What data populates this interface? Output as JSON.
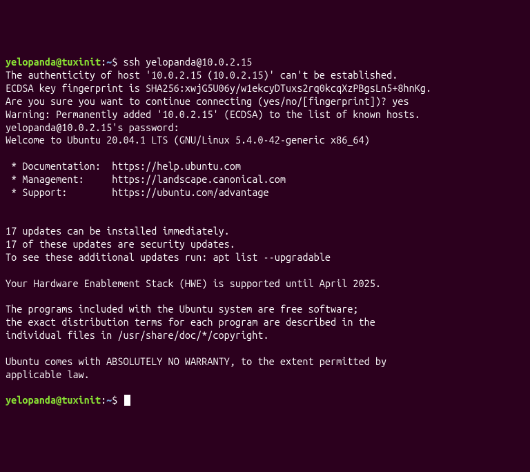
{
  "prompt1": {
    "userhost": "yelopanda@tuxinit",
    "colon": ":",
    "path": "~",
    "dollar": "$ ",
    "command": "ssh yelopanda@10.0.2.15"
  },
  "lines": {
    "auth": "The authenticity of host '10.0.2.15 (10.0.2.15)' can't be established.",
    "fingerprint": "ECDSA key fingerprint is SHA256:xwjG5U06y/w1ekcyDTuxs2rq0kcqXzPBgsLn5+8hnKg.",
    "confirm": "Are you sure you want to continue connecting (yes/no/[fingerprint])? yes",
    "warning": "Warning: Permanently added '10.0.2.15' (ECDSA) to the list of known hosts.",
    "password": "yelopanda@10.0.2.15's password:",
    "welcome": "Welcome to Ubuntu 20.04.1 LTS (GNU/Linux 5.4.0-42-generic x86_64)",
    "blank": "",
    "doc": " * Documentation:  https://help.ubuntu.com",
    "mgmt": " * Management:     https://landscape.canonical.com",
    "support": " * Support:        https://ubuntu.com/advantage",
    "updates1": "17 updates can be installed immediately.",
    "updates2": "17 of these updates are security updates.",
    "updates3": "To see these additional updates run: apt list --upgradable",
    "hwe": "Your Hardware Enablement Stack (HWE) is supported until April 2025.",
    "free1": "The programs included with the Ubuntu system are free software;",
    "free2": "the exact distribution terms for each program are described in the",
    "free3": "individual files in /usr/share/doc/*/copyright.",
    "warranty1": "Ubuntu comes with ABSOLUTELY NO WARRANTY, to the extent permitted by",
    "warranty2": "applicable law."
  },
  "prompt2": {
    "userhost": "yelopanda@tuxinit",
    "colon": ":",
    "path": "~",
    "dollar": "$ "
  }
}
